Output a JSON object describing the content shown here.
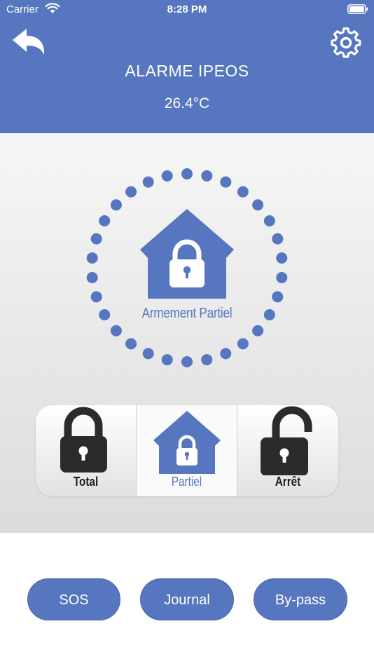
{
  "status_bar": {
    "carrier": "Carrier",
    "time": "8:28 PM"
  },
  "header": {
    "title": "ALARME IPEOS",
    "temperature": "26.4°C",
    "back_icon": "back-arrow-icon",
    "settings_icon": "gear-icon"
  },
  "status": {
    "label": "Armement Partiel",
    "icon": "house-lock-icon"
  },
  "modes": [
    {
      "label": "Total",
      "icon": "padlock-closed-icon"
    },
    {
      "label": "Partiel",
      "icon": "house-lock-icon"
    },
    {
      "label": "Arrêt",
      "icon": "padlock-open-icon"
    }
  ],
  "actions": [
    {
      "label": "SOS"
    },
    {
      "label": "Journal"
    },
    {
      "label": "By-pass"
    }
  ],
  "colors": {
    "accent": "#5676bf",
    "dark_icon": "#2b2b2b",
    "panel_top": "#f6f6f6",
    "panel_bottom": "#dcdcdc"
  }
}
